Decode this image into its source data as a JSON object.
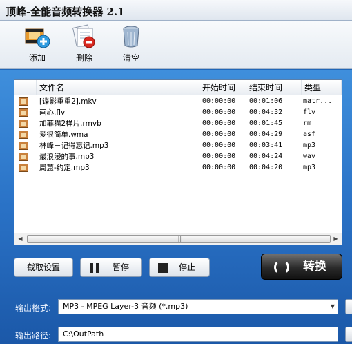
{
  "window": {
    "title": "顶峰-全能音频转换器 2.1"
  },
  "toolbar": {
    "add": {
      "label": "添加",
      "icon": "add-film-icon"
    },
    "delete": {
      "label": "删除",
      "icon": "delete-doc-icon"
    },
    "clear": {
      "label": "清空",
      "icon": "clear-bin-icon"
    }
  },
  "list": {
    "columns": [
      "文件名",
      "开始时间",
      "结束时间",
      "类型"
    ],
    "rows": [
      {
        "name": "[谍影重重2].mkv",
        "start": "00:00:00",
        "end": "00:01:06",
        "type": "matr..."
      },
      {
        "name": "画心.flv",
        "start": "00:00:00",
        "end": "00:04:32",
        "type": "flv"
      },
      {
        "name": "加菲猫2样片.rmvb",
        "start": "00:00:00",
        "end": "00:01:45",
        "type": "rm"
      },
      {
        "name": "爱很简单.wma",
        "start": "00:00:00",
        "end": "00:04:29",
        "type": "asf"
      },
      {
        "name": "林峰－记得忘记.mp3",
        "start": "00:00:00",
        "end": "00:03:41",
        "type": "mp3"
      },
      {
        "name": "最浪漫的事.mp3",
        "start": "00:00:00",
        "end": "00:04:24",
        "type": "wav"
      },
      {
        "name": "周蕙-约定.mp3",
        "start": "00:00:00",
        "end": "00:04:20",
        "type": "mp3"
      }
    ]
  },
  "controls": {
    "clip_label": "截取设置",
    "pause_label": "暂停",
    "stop_label": "停止",
    "convert_label": "转换"
  },
  "output": {
    "format_label": "输出格式:",
    "format_value": "MP3 - MPEG Layer-3 音频 (*.mp3)",
    "path_label": "输出路径:",
    "path_value": "C:\\OutPath"
  },
  "colors": {
    "accent": "#2a72c6",
    "convert_bg": "#2a2a2a"
  }
}
